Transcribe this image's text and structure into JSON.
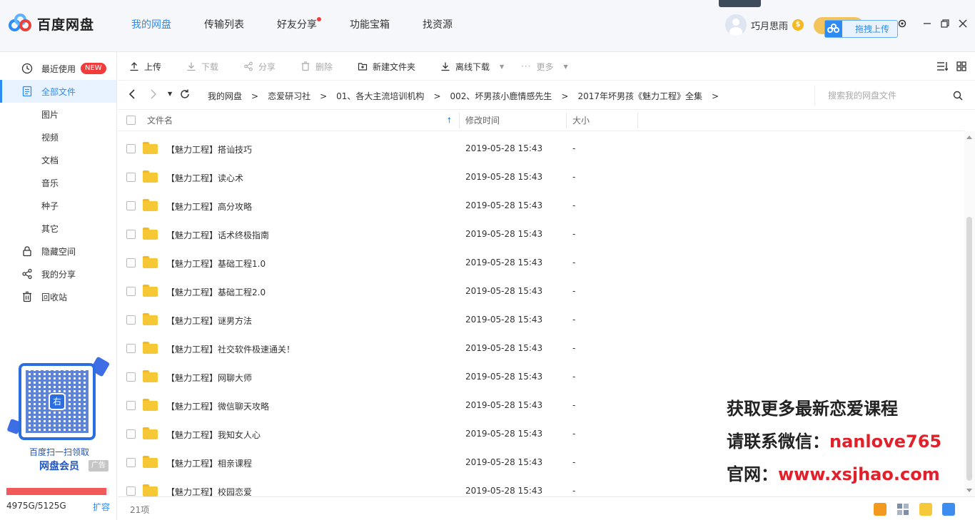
{
  "app": {
    "logo_text": "百度网盘"
  },
  "nav": {
    "items": [
      "我的网盘",
      "传输列表",
      "好友分享",
      "功能宝箱",
      "找资源"
    ],
    "active_index": 0
  },
  "user": {
    "name": "巧月思雨",
    "coin_glyph": "$"
  },
  "upload_float": {
    "label": "拖拽上传"
  },
  "sidebar": {
    "items": [
      {
        "label": "最近使用",
        "badge": "NEW"
      },
      {
        "label": "全部文件"
      },
      {
        "label": "图片"
      },
      {
        "label": "视频"
      },
      {
        "label": "文档"
      },
      {
        "label": "音乐"
      },
      {
        "label": "种子"
      },
      {
        "label": "其它"
      },
      {
        "label": "隐藏空间"
      },
      {
        "label": "我的分享"
      },
      {
        "label": "回收站"
      }
    ],
    "active_index": 1,
    "promo": {
      "line1": "百度扫一扫领取",
      "line2": "网盘会员",
      "ad_tag": "广告",
      "qr_glyph": "右"
    },
    "quota": {
      "text": "4975G/5125G",
      "used_fraction": 0.971,
      "expand": "扩容"
    }
  },
  "toolbar": {
    "upload": "上传",
    "download": "下载",
    "share": "分享",
    "delete": "删除",
    "new_folder": "新建文件夹",
    "offline_download": "离线下载",
    "more": "更多"
  },
  "breadcrumb": {
    "items": [
      "我的网盘",
      "恋爱研习社",
      "01、各大主流培训机构",
      "002、坏男孩小鹿情感先生",
      "2017年坏男孩《魅力工程》全集"
    ],
    "separator": ">"
  },
  "search": {
    "placeholder": "搜索我的网盘文件"
  },
  "table": {
    "headers": {
      "name": "文件名",
      "modified": "修改时间",
      "size": "大小"
    },
    "rows": [
      {
        "name": "【魅力工程】搭讪技巧",
        "modified": "2019-05-28 15:43",
        "size": "-"
      },
      {
        "name": "【魅力工程】读心术",
        "modified": "2019-05-28 15:43",
        "size": "-"
      },
      {
        "name": "【魅力工程】高分攻略",
        "modified": "2019-05-28 15:43",
        "size": "-"
      },
      {
        "name": "【魅力工程】话术终极指南",
        "modified": "2019-05-28 15:43",
        "size": "-"
      },
      {
        "name": "【魅力工程】基础工程1.0",
        "modified": "2019-05-28 15:43",
        "size": "-"
      },
      {
        "name": "【魅力工程】基础工程2.0",
        "modified": "2019-05-28 15:43",
        "size": "-"
      },
      {
        "name": "【魅力工程】谜男方法",
        "modified": "2019-05-28 15:43",
        "size": "-"
      },
      {
        "name": "【魅力工程】社交软件极速通关！",
        "modified": "2019-05-28 15:43",
        "size": "-"
      },
      {
        "name": "【魅力工程】网聊大师",
        "modified": "2019-05-28 15:43",
        "size": "-"
      },
      {
        "name": "【魅力工程】微信聊天攻略",
        "modified": "2019-05-28 15:43",
        "size": "-"
      },
      {
        "name": "【魅力工程】我知女人心",
        "modified": "2019-05-28 15:43",
        "size": "-"
      },
      {
        "name": "【魅力工程】相亲课程",
        "modified": "2019-05-28 15:43",
        "size": "-"
      },
      {
        "name": "【魅力工程】校园恋爱",
        "modified": "2019-05-28 15:43",
        "size": "-"
      }
    ]
  },
  "footer": {
    "count": "21项"
  },
  "overlay": {
    "line1": "获取更多最新恋爱课程",
    "line2_prefix": "请联系微信：",
    "line2_value": "nanlove765",
    "line3_prefix": "官网：",
    "line3_value": "www.xsjhao.com"
  },
  "colors": {
    "accent": "#2c8cf4",
    "badge": "#f23c3c",
    "folder": "#f7c836",
    "quota": "#f2595b",
    "overlay_red": "#e0212b"
  }
}
